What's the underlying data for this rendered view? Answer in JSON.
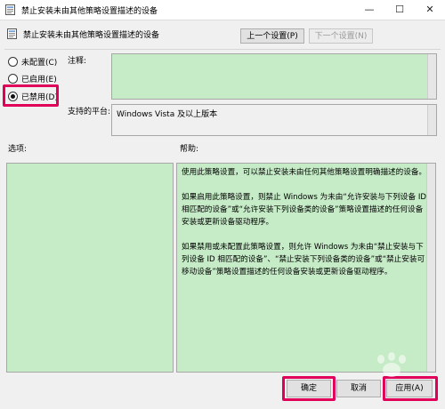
{
  "window": {
    "title": "禁止安装未由其他策略设置描述的设备",
    "minimize_glyph": "—",
    "maximize_glyph": "☐",
    "close_glyph": "✕"
  },
  "header": {
    "title": "禁止安装未由其他策略设置描述的设备",
    "prev_button": "上一个设置(P)",
    "next_button": "下一个设置(N)"
  },
  "state": {
    "options": [
      {
        "label": "未配置(C)",
        "selected": false
      },
      {
        "label": "已启用(E)",
        "selected": false
      },
      {
        "label": "已禁用(D)",
        "selected": true
      }
    ]
  },
  "comment": {
    "label": "注释:",
    "value": ""
  },
  "platform": {
    "label": "支持的平台:",
    "value": "Windows Vista 及以上版本"
  },
  "options_panel": {
    "label": "选项:"
  },
  "help": {
    "label": "帮助:",
    "paragraphs": [
      "使用此策略设置，可以禁止安装未由任何其他策略设置明确描述的设备。",
      "如果启用此策略设置，则禁止 Windows 为未由“允许安装与下列设备 ID 相匹配的设备”或“允许安装下列设备类的设备”策略设置描述的任何设备安装或更新设备驱动程序。",
      "如果禁用或未配置此策略设置，则允许 Windows 为未由“禁止安装与下列设备 ID 相匹配的设备”、“禁止安装下列设备类的设备”或“禁止安装可移动设备”策略设置描述的任何设备安装或更新设备驱动程序。"
    ]
  },
  "buttons": {
    "ok": "确定",
    "cancel": "取消",
    "apply": "应用(A)"
  },
  "colors": {
    "panel_green": "#c6ebc7",
    "highlight": "#e0005a"
  }
}
